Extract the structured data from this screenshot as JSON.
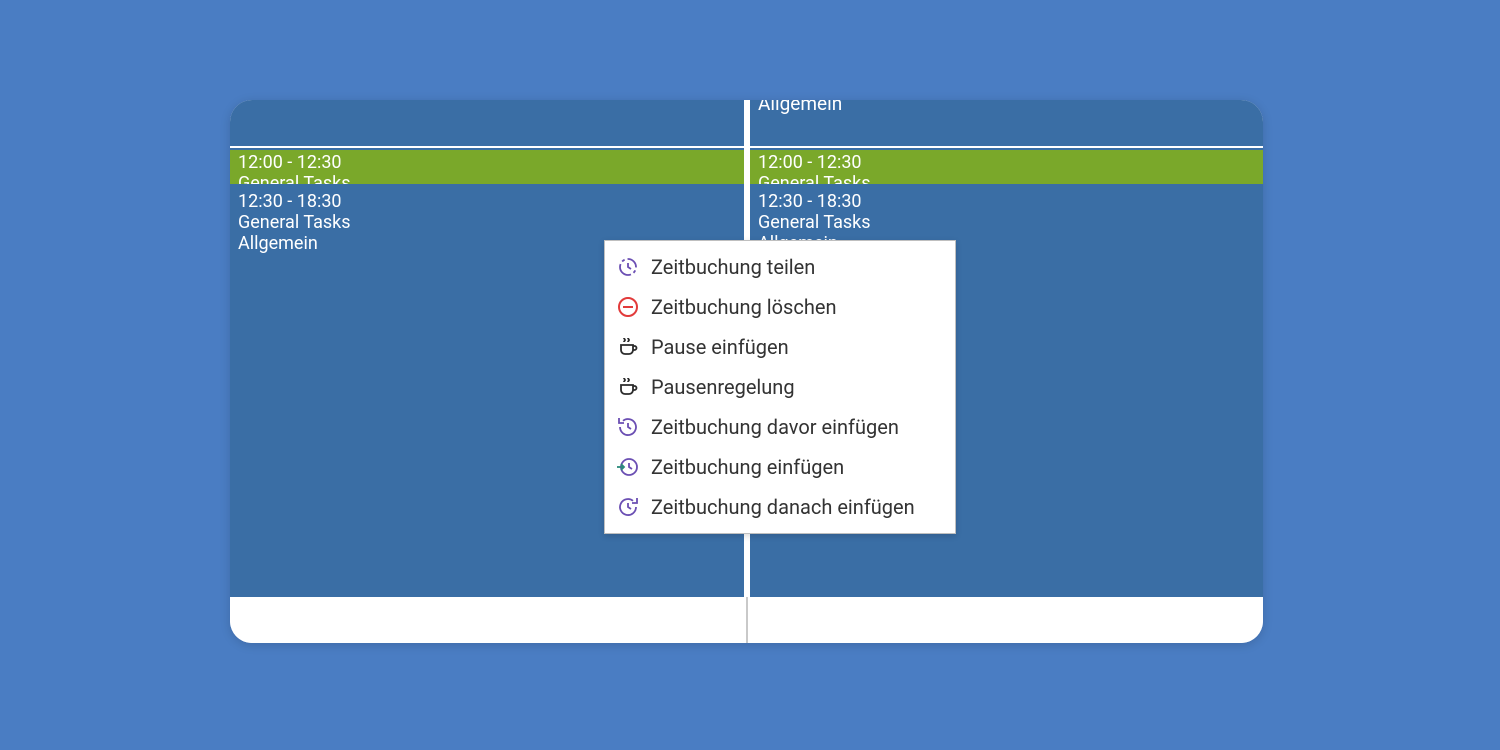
{
  "calendar": {
    "top_partial_label": "Allgemein",
    "columns": [
      {
        "green": {
          "time": "12:00 - 12:30",
          "title_truncated": "General Tasks"
        },
        "blue": {
          "time": "12:30 - 18:30",
          "title": "General Tasks",
          "subtitle": "Allgemein"
        }
      },
      {
        "green": {
          "time": "12:00 - 12:30",
          "title_truncated": "General Tasks"
        },
        "blue": {
          "time": "12:30 - 18:30",
          "title": "General Tasks",
          "subtitle": "Allgemein"
        }
      }
    ]
  },
  "context_menu": {
    "items": [
      {
        "icon": "clock-split-icon",
        "label": "Zeitbuchung teilen"
      },
      {
        "icon": "circle-minus-icon",
        "label": "Zeitbuchung löschen"
      },
      {
        "icon": "coffee-cup-icon",
        "label": "Pause einfügen"
      },
      {
        "icon": "coffee-cup-icon",
        "label": "Pausenregelung"
      },
      {
        "icon": "clock-back-arrow-icon",
        "label": "Zeitbuchung davor einfügen"
      },
      {
        "icon": "clock-arrow-in-icon",
        "label": "Zeitbuchung einfügen"
      },
      {
        "icon": "clock-forward-arrow-icon",
        "label": "Zeitbuchung danach einfügen"
      }
    ]
  },
  "colors": {
    "page_bg": "#4a7dc3",
    "calendar_bg": "#3a6ea5",
    "green_row": "#7aa82a",
    "menu_purple": "#6b4fb3",
    "menu_red": "#e23b3b",
    "menu_dark": "#2b2b2b",
    "menu_teal": "#2a8a7a"
  }
}
